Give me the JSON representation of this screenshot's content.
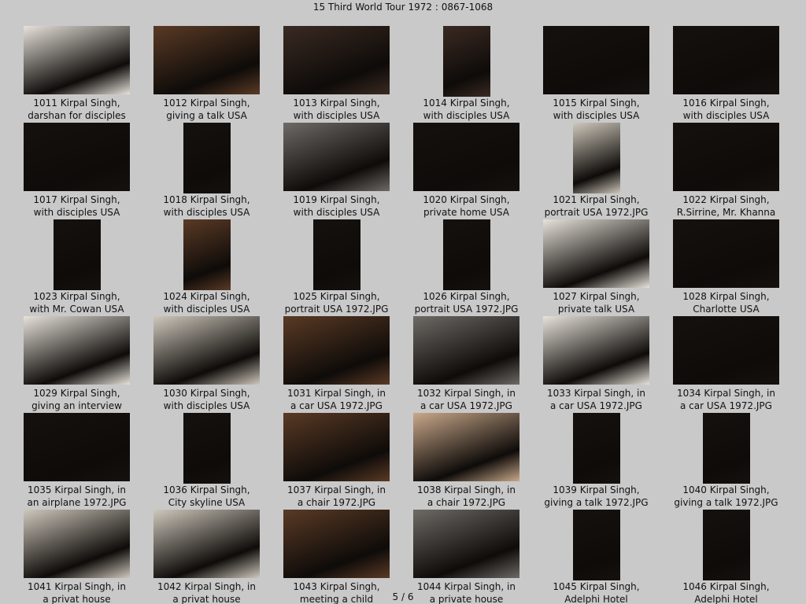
{
  "title": "15 Third World Tour 1972 : 0867-1068",
  "pager": "5 / 6",
  "thumbnails": [
    {
      "l1": "1011  Kirpal Singh,",
      "l2": "darshan for disciples",
      "shape": "landscape",
      "tone": "bright"
    },
    {
      "l1": "1012  Kirpal Singh,",
      "l2": "giving a talk USA",
      "shape": "landscape",
      "tone": "warm"
    },
    {
      "l1": "1013  Kirpal Singh,",
      "l2": "with disciples USA",
      "shape": "landscape",
      "tone": "crowd"
    },
    {
      "l1": "1014  Kirpal Singh,",
      "l2": "with disciples USA",
      "shape": "narrow",
      "tone": "crowd"
    },
    {
      "l1": "1015  Kirpal Singh,",
      "l2": "with disciples USA",
      "shape": "landscape",
      "tone": "dark"
    },
    {
      "l1": "1016  Kirpal Singh,",
      "l2": "with disciples USA",
      "shape": "landscape",
      "tone": "dark"
    },
    {
      "l1": "1017  Kirpal Singh,",
      "l2": "with disciples USA",
      "shape": "landscape",
      "tone": "dark"
    },
    {
      "l1": "1018  Kirpal Singh,",
      "l2": "with disciples USA",
      "shape": "narrow",
      "tone": "dark"
    },
    {
      "l1": "1019  Kirpal Singh,",
      "l2": "with disciples USA",
      "shape": "landscape",
      "tone": "mixed"
    },
    {
      "l1": "1020  Kirpal Singh,",
      "l2": "private home USA",
      "shape": "landscape",
      "tone": "dark"
    },
    {
      "l1": "1021  Kirpal Singh,",
      "l2": "portrait USA 1972.JPG",
      "shape": "narrow",
      "tone": "light"
    },
    {
      "l1": "1022  Kirpal Singh,",
      "l2": "R.Sirrine, Mr. Khanna",
      "shape": "landscape",
      "tone": "dark"
    },
    {
      "l1": "1023  Kirpal Singh,",
      "l2": "with Mr. Cowan USA",
      "shape": "narrow",
      "tone": "dark"
    },
    {
      "l1": "1024  Kirpal Singh,",
      "l2": "with disciples USA",
      "shape": "narrow",
      "tone": "warm"
    },
    {
      "l1": "1025  Kirpal Singh,",
      "l2": "portrait USA 1972.JPG",
      "shape": "narrow",
      "tone": "dark"
    },
    {
      "l1": "1026  Kirpal Singh,",
      "l2": "portrait USA 1972.JPG",
      "shape": "narrow",
      "tone": "dark"
    },
    {
      "l1": "1027  Kirpal Singh,",
      "l2": "private talk USA",
      "shape": "landscape",
      "tone": "bright"
    },
    {
      "l1": "1028  Kirpal Singh,",
      "l2": "Charlotte USA",
      "shape": "landscape",
      "tone": "dark"
    },
    {
      "l1": "1029  Kirpal Singh,",
      "l2": "giving an interview",
      "shape": "landscape",
      "tone": "bright"
    },
    {
      "l1": "1030  Kirpal Singh,",
      "l2": "with disciples USA",
      "shape": "landscape",
      "tone": "light"
    },
    {
      "l1": "1031  Kirpal Singh, in",
      "l2": "a car USA 1972.JPG",
      "shape": "landscape",
      "tone": "warm"
    },
    {
      "l1": "1032  Kirpal Singh, in",
      "l2": "a car USA 1972.JPG",
      "shape": "landscape",
      "tone": "mixed"
    },
    {
      "l1": "1033  Kirpal Singh, in",
      "l2": "a car USA 1972.JPG",
      "shape": "landscape",
      "tone": "bright"
    },
    {
      "l1": "1034  Kirpal Singh, in",
      "l2": "a car USA 1972.JPG",
      "shape": "landscape",
      "tone": "dark"
    },
    {
      "l1": "1035  Kirpal Singh, in",
      "l2": "an airplane 1972.JPG",
      "shape": "landscape",
      "tone": "dark"
    },
    {
      "l1": "1036  Kirpal Singh,",
      "l2": "City skyline USA",
      "shape": "narrow",
      "tone": "dark"
    },
    {
      "l1": "1037  Kirpal Singh, in",
      "l2": "a chair 1972.JPG",
      "shape": "landscape",
      "tone": "warm"
    },
    {
      "l1": "1038  Kirpal Singh, in",
      "l2": "a chair 1972.JPG",
      "shape": "landscape",
      "tone": "beige"
    },
    {
      "l1": "1039  Kirpal Singh,",
      "l2": "giving a talk 1972.JPG",
      "shape": "narrow",
      "tone": "dark"
    },
    {
      "l1": "1040  Kirpal Singh,",
      "l2": "giving a talk 1972.JPG",
      "shape": "narrow",
      "tone": "dark"
    },
    {
      "l1": "1041  Kirpal Singh, in",
      "l2": "a privat house",
      "shape": "landscape",
      "tone": "light"
    },
    {
      "l1": "1042  Kirpal Singh, in",
      "l2": "a privat house",
      "shape": "landscape",
      "tone": "light"
    },
    {
      "l1": "1043  Kirpal Singh,",
      "l2": "meeting a child",
      "shape": "landscape",
      "tone": "warm"
    },
    {
      "l1": "1044  Kirpal Singh, in",
      "l2": "a private house",
      "shape": "landscape",
      "tone": "mixed"
    },
    {
      "l1": "1045  Kirpal Singh,",
      "l2": "Adelphi Hotel",
      "shape": "narrow",
      "tone": "dark"
    },
    {
      "l1": "1046  Kirpal Singh,",
      "l2": "Adelphi Hotel",
      "shape": "narrow",
      "tone": "dark"
    }
  ],
  "tone_colors": {
    "bright": "#e7e2da",
    "light": "#cfc8bc",
    "beige": "#c9a88a",
    "warm": "#5a3a25",
    "crowd": "#3a2a22",
    "mixed": "#6e6a66",
    "dark": "#15110e"
  }
}
